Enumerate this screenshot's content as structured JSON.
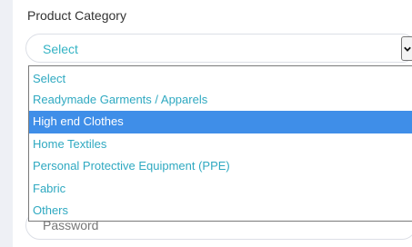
{
  "form": {
    "category_label": "Product Category",
    "category_select": {
      "value": "Select",
      "options": [
        "Select",
        "Readymade Garments / Apparels",
        "High end Clothes",
        "Home Textiles",
        "Personal Protective Equipment (PPE)",
        "Fabric",
        "Others"
      ],
      "highlighted_index": 2
    },
    "password_placeholder": "Password"
  },
  "colors": {
    "option_text": "#2fa9c1",
    "highlight_bg": "#3f8ee8",
    "highlight_text": "#ffffff",
    "select_value_text": "#34b3c4"
  },
  "icons": {
    "dropdown_arrow": "chevron-down-icon"
  }
}
